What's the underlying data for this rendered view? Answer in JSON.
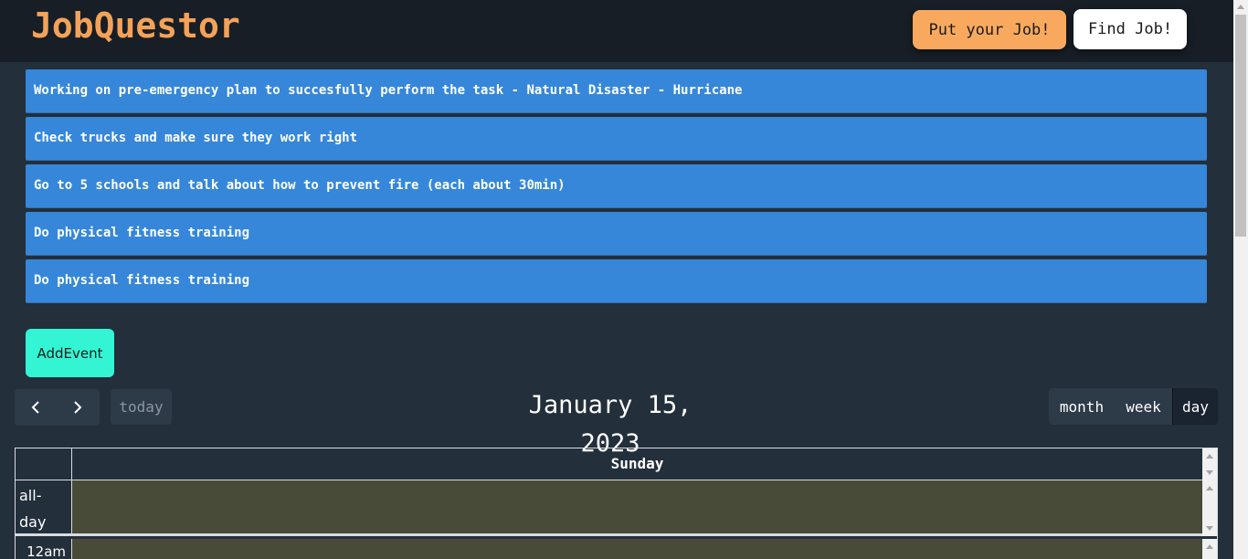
{
  "header": {
    "logo": "JobQuestor",
    "put_job_label": "Put your Job!",
    "find_job_label": "Find Job!"
  },
  "tasks": [
    "Working on pre-emergency plan to succesfully perform the task - Natural Disaster - Hurricane",
    "Check trucks and make sure they work right",
    "Go to 5 schools and talk about how to prevent fire (each about 30min)",
    "Do physical fitness training",
    "Do physical fitness training"
  ],
  "add_event_label": "AddEvent",
  "calendar": {
    "prev_icon": "chevron-left-icon",
    "next_icon": "chevron-right-icon",
    "today_label": "today",
    "title": "January 15, 2023",
    "views": {
      "month": "month",
      "week": "week",
      "day": "day",
      "active": "day"
    },
    "day_header": "Sunday",
    "allday_label": "all-day",
    "time_slots": [
      "12am"
    ]
  },
  "colors": {
    "header_bg": "#171e26",
    "page_bg": "#232f3b",
    "logo": "#f4a259",
    "put_job_button": "#f9a95e",
    "task_bar": "#3687d9",
    "add_event_button": "#33f5d4",
    "today_highlight": "#474b38"
  }
}
